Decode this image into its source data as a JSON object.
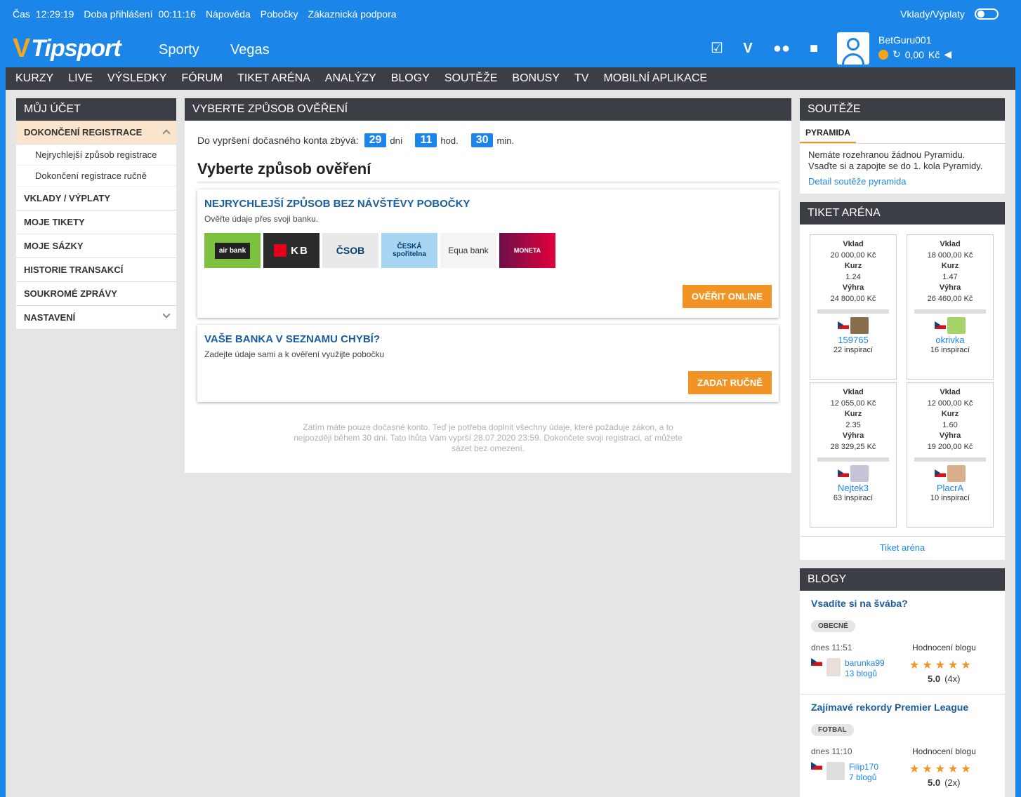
{
  "topbar": {
    "time_label": "Čas",
    "time_value": "12:29:19",
    "login_label": "Doba přihlášení",
    "login_value": "00:11:16",
    "links": [
      "Nápověda",
      "Pobočky",
      "Zákaznická podpora"
    ],
    "deposits_label": "Vklady/Výplaty"
  },
  "header": {
    "logo": "Tipsport",
    "nav": [
      "Sporty",
      "Vegas"
    ],
    "username": "BetGuru001",
    "balance": "0,00",
    "currency": "Kč",
    "brand_color": "#1c86e8",
    "accent_color": "#f19425"
  },
  "mainnav": [
    "KURZY",
    "LIVE",
    "VÝSLEDKY",
    "FÓRUM",
    "TIKET ARÉNA",
    "ANALÝZY",
    "BLOGY",
    "SOUTĚŽE",
    "BONUSY",
    "TV",
    "MOBILNÍ APLIKACE"
  ],
  "account": {
    "title": "MŮJ ÚČET",
    "active": "DOKONČENÍ REGISTRACE",
    "sub": [
      "Nejrychlejší způsob registrace",
      "Dokončení registrace ručně"
    ],
    "items": [
      "VKLADY / VÝPLATY",
      "MOJE TIKETY",
      "MOJE SÁZKY",
      "HISTORIE TRANSAKCÍ",
      "SOUKROMÉ ZPRÁVY",
      "NASTAVENÍ"
    ]
  },
  "verify": {
    "title": "VYBERTE ZPŮSOB OVĚŘENÍ",
    "timer_label": "Do vypršení dočasného konta zbývá:",
    "days": "29",
    "days_unit": "dní",
    "hours": "11",
    "hours_unit": "hod.",
    "minutes": "30",
    "minutes_unit": "min.",
    "heading": "Vyberte způsob ověření",
    "online_title": "NEJRYCHLEJŠÍ ZPŮSOB BEZ NÁVŠTĚVY POBOČKY",
    "online_text": "Ověřte údaje přes svoji banku.",
    "banks": [
      "air bank",
      "KB",
      "ČSOB",
      "ČESKÁ spořitelna",
      "Equa bank",
      "MONETA"
    ],
    "online_button": "OVĚŘIT ONLINE",
    "manual_title": "VAŠE BANKA V SEZNAMU CHYBÍ?",
    "manual_text": "Zadejte údaje sami a k ověření využijte pobočku",
    "manual_button": "ZADAT RUČNĚ",
    "notice": "Zatím máte pouze dočasné konto. Teď je potřeba doplnit všechny údaje, které požaduje zákon, a to nejpozději během 30 dní. Tato lhůta Vám vyprší 28.07.2020 23:59. Dokončete svoji registraci, ať můžete sázet bez omezení."
  },
  "competitions": {
    "title": "SOUTĚŽE",
    "tab": "PYRAMIDA",
    "text": "Nemáte rozehranou žádnou Pyramidu. Vsaďte si a zapojte se do 1. kola Pyramidy.",
    "link": "Detail soutěže pyramida"
  },
  "arena": {
    "title": "TIKET ARÉNA",
    "labels": {
      "stake": "Vklad",
      "odds": "Kurz",
      "win": "Výhra"
    },
    "tickets": [
      {
        "stake": "20 000,00 Kč",
        "odds": "1.24",
        "win": "24 800,00 Kč",
        "nick": "159765",
        "insp": "22 inspirací"
      },
      {
        "stake": "18 000,00 Kč",
        "odds": "1.47",
        "win": "26 460,00 Kč",
        "nick": "okrivka",
        "insp": "16 inspirací"
      },
      {
        "stake": "12 055,00 Kč",
        "odds": "2.35",
        "win": "28 329,25 Kč",
        "nick": "Nejtek3",
        "insp": "63 inspirací"
      },
      {
        "stake": "12 000,00 Kč",
        "odds": "1.60",
        "win": "19 200,00 Kč",
        "nick": "PlacrA",
        "insp": "10 inspirací"
      }
    ],
    "link": "Tiket aréna"
  },
  "blogs": {
    "title": "BLOGY",
    "rating_label": "Hodnocení blogu",
    "items": [
      {
        "title": "Vsadíte si na švába?",
        "category": "OBECNÉ",
        "when": "dnes 11:51",
        "author": "barunka99",
        "count": "13 blogů",
        "score": "5.0",
        "votes": "(4x)"
      },
      {
        "title": "Zajímavé rekordy Premier League",
        "category": "FOTBAL",
        "when": "dnes 11:10",
        "author": "Filip170",
        "count": "7 blogů",
        "score": "5.0",
        "votes": "(2x)"
      }
    ]
  }
}
